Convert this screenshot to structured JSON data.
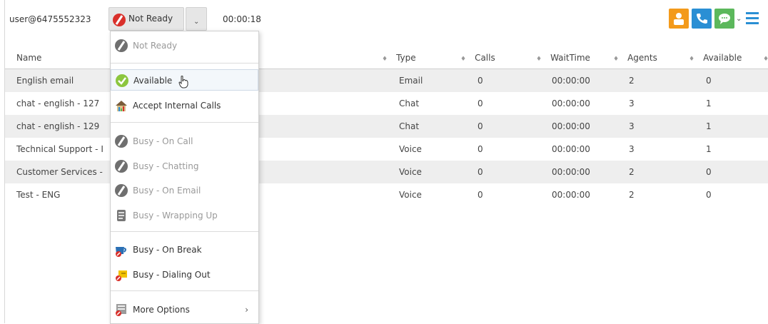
{
  "header": {
    "user": "user@6475552323",
    "status_label": "Not Ready",
    "caret": "⌄",
    "timer": "00:00:18"
  },
  "colors": {
    "accent_blue": "#2a8fd4",
    "orange": "#f39a1b",
    "green": "#5cb85c"
  },
  "table": {
    "columns": [
      "Name",
      "Type",
      "Calls",
      "WaitTime",
      "Agents",
      "Available"
    ],
    "sort_glyph": "♦",
    "rows": [
      {
        "name": "English email",
        "type": "Email",
        "calls": "0",
        "wait": "00:00:00",
        "agents": "2",
        "available": "0"
      },
      {
        "name": "chat - english - 127",
        "type": "Chat",
        "calls": "0",
        "wait": "00:00:00",
        "agents": "3",
        "available": "1"
      },
      {
        "name": "chat - english - 129",
        "type": "Chat",
        "calls": "0",
        "wait": "00:00:00",
        "agents": "3",
        "available": "1"
      },
      {
        "name": "Technical Support - I",
        "type": "Voice",
        "calls": "0",
        "wait": "00:00:00",
        "agents": "3",
        "available": "1"
      },
      {
        "name": "Customer Services -",
        "type": "Voice",
        "calls": "0",
        "wait": "00:00:00",
        "agents": "2",
        "available": "0"
      },
      {
        "name": "Test - ENG",
        "type": "Voice",
        "calls": "0",
        "wait": "00:00:00",
        "agents": "2",
        "available": "0"
      }
    ]
  },
  "menu": {
    "items": [
      {
        "label": "Not Ready",
        "icon": "not-ready-icon"
      },
      {
        "label": "Available",
        "icon": "available-icon"
      },
      {
        "label": "Accept Internal Calls",
        "icon": "internal-calls-icon"
      },
      {
        "label": "Busy - On Call",
        "icon": "busy-icon"
      },
      {
        "label": "Busy - Chatting",
        "icon": "busy-icon"
      },
      {
        "label": "Busy - On Email",
        "icon": "busy-icon"
      },
      {
        "label": "Busy - Wrapping Up",
        "icon": "wrapping-up-icon"
      },
      {
        "label": "Busy - On Break",
        "icon": "break-icon"
      },
      {
        "label": "Busy - Dialing Out",
        "icon": "dialing-out-icon"
      },
      {
        "label": "More Options",
        "icon": "more-options-icon"
      }
    ],
    "more_arrow": "›"
  }
}
